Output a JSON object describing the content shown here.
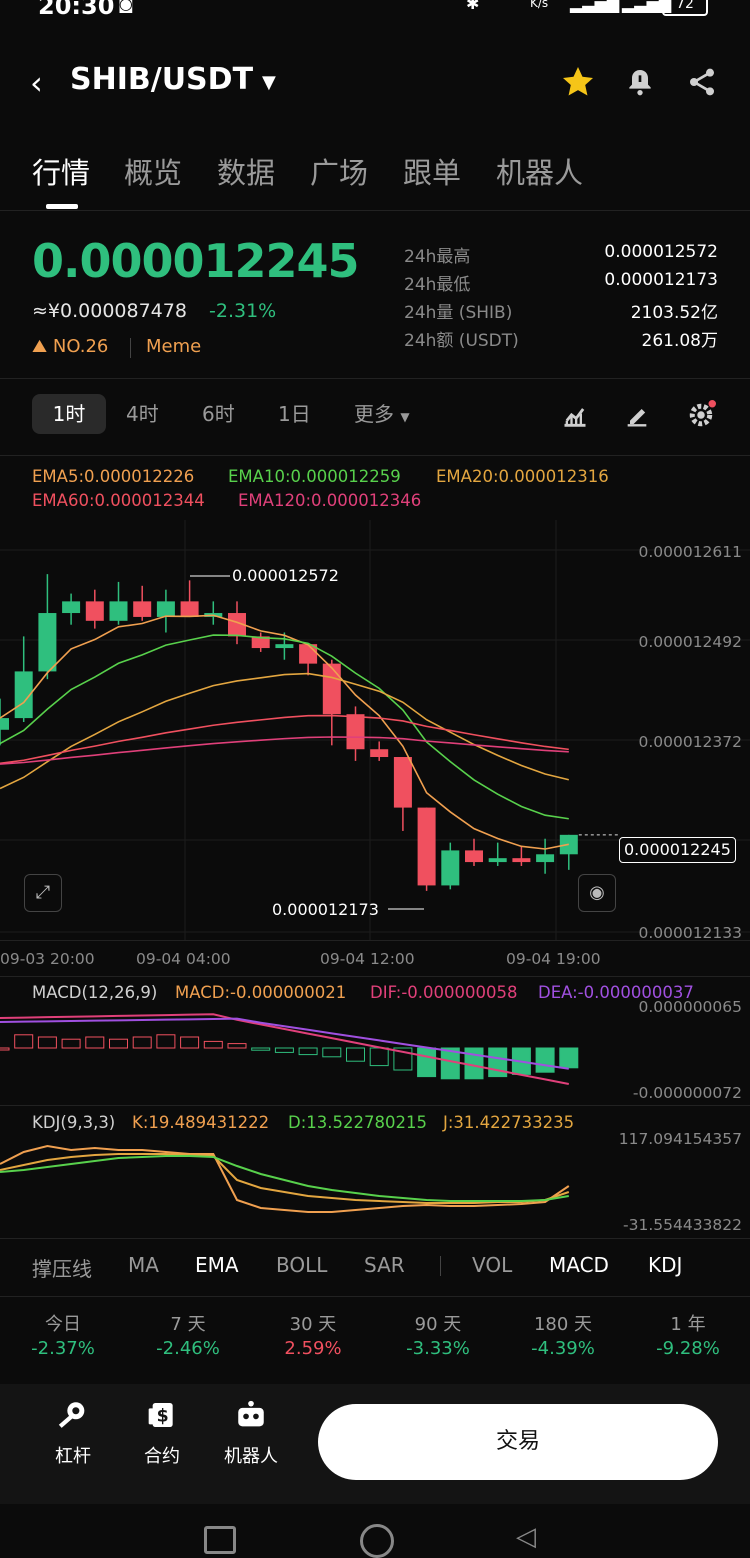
{
  "status_bar": {
    "time": "20:30",
    "battery": "72",
    "net_unit": "K/s"
  },
  "header": {
    "pair": "SHIB/USDT"
  },
  "tabs": [
    "行情",
    "概览",
    "数据",
    "广场",
    "跟单",
    "机器人"
  ],
  "ticker": {
    "price": "0.000012245",
    "fiat": "≈¥0.000087478",
    "change": "-2.31%",
    "rank": "NO.26",
    "tag": "Meme",
    "stats": [
      {
        "label": "24h最高",
        "value": "0.000012572"
      },
      {
        "label": "24h最低",
        "value": "0.000012173"
      },
      {
        "label": "24h量 (SHIB)",
        "value": "2103.52亿"
      },
      {
        "label": "24h额 (USDT)",
        "value": "261.08万"
      }
    ]
  },
  "timeframes": {
    "items": [
      "1时",
      "4时",
      "6时",
      "1日"
    ],
    "more": "更多"
  },
  "ema_legend": {
    "ema5": "EMA5:0.000012226",
    "ema10": "EMA10:0.000012259",
    "ema20": "EMA20:0.000012316",
    "ema60": "EMA60:0.000012344",
    "ema120": "EMA120:0.000012346"
  },
  "price_axis": [
    "0.000012611",
    "0.000012492",
    "0.000012372",
    "0.000012133"
  ],
  "current_price_tag": "0.000012245",
  "high_marker": "0.000012572",
  "low_marker": "0.000012173",
  "time_axis": [
    "09-03 20:00",
    "09-04 04:00",
    "09-04 12:00",
    "09-04 19:00"
  ],
  "macd": {
    "name": "MACD(12,26,9)",
    "macd": "MACD:-0.000000021",
    "dif": "DIF:-0.000000058",
    "dea": "DEA:-0.000000037",
    "axis_top": "0.000000065",
    "axis_bottom": "-0.000000072"
  },
  "kdj": {
    "name": "KDJ(9,3,3)",
    "k": "K:19.489431222",
    "d": "D:13.522780215",
    "j": "J:31.422733235",
    "axis_top": "117.094154357",
    "axis_bottom": "-31.554433822"
  },
  "indicator_tabs": [
    "撑压线",
    "MA",
    "EMA",
    "BOLL",
    "SAR",
    "VOL",
    "MACD",
    "KDJ"
  ],
  "performance": [
    {
      "period": "今日",
      "value": "-2.37%"
    },
    {
      "period": "7 天",
      "value": "-2.46%"
    },
    {
      "period": "30 天",
      "value": "2.59%"
    },
    {
      "period": "90 天",
      "value": "-3.33%"
    },
    {
      "period": "180 天",
      "value": "-4.39%"
    },
    {
      "period": "1 年",
      "value": "-9.28%"
    }
  ],
  "bottom_nav": {
    "leverage": "杠杆",
    "contract": "合约",
    "robot": "机器人",
    "trade": "交易"
  },
  "colors": {
    "up": "#2fbf7e",
    "down": "#f0505f",
    "accent": "#f0a050",
    "star": "#f5c518"
  },
  "chart_data": {
    "type": "candlestick",
    "interval": "1h",
    "candles_ohlc": [
      [
        1.238e-05,
        1.242e-05,
        1.236e-05,
        1.2395e-05
      ],
      [
        1.2395e-05,
        1.25e-05,
        1.239e-05,
        1.2455e-05
      ],
      [
        1.2455e-05,
        1.258e-05,
        1.2445e-05,
        1.253e-05
      ],
      [
        1.253e-05,
        1.2555e-05,
        1.2515e-05,
        1.2545e-05
      ],
      [
        1.2545e-05,
        1.256e-05,
        1.251e-05,
        1.252e-05
      ],
      [
        1.252e-05,
        1.257e-05,
        1.2515e-05,
        1.2545e-05
      ],
      [
        1.2545e-05,
        1.2565e-05,
        1.252e-05,
        1.2525e-05
      ],
      [
        1.2525e-05,
        1.256e-05,
        1.2505e-05,
        1.2545e-05
      ],
      [
        1.2545e-05,
        1.2572e-05,
        1.2525e-05,
        1.2525e-05
      ],
      [
        1.2525e-05,
        1.2545e-05,
        1.2515e-05,
        1.253e-05
      ],
      [
        1.253e-05,
        1.2545e-05,
        1.249e-05,
        1.25e-05
      ],
      [
        1.25e-05,
        1.2505e-05,
        1.248e-05,
        1.2485e-05
      ],
      [
        1.2485e-05,
        1.2505e-05,
        1.247e-05,
        1.249e-05
      ],
      [
        1.249e-05,
        1.249e-05,
        1.245e-05,
        1.2465e-05
      ],
      [
        1.2465e-05,
        1.247e-05,
        1.236e-05,
        1.24e-05
      ],
      [
        1.24e-05,
        1.241e-05,
        1.234e-05,
        1.2355e-05
      ],
      [
        1.2355e-05,
        1.2365e-05,
        1.234e-05,
        1.2345e-05
      ],
      [
        1.2345e-05,
        1.2345e-05,
        1.225e-05,
        1.228e-05
      ],
      [
        1.228e-05,
        1.228e-05,
        1.2173e-05,
        1.218e-05
      ],
      [
        1.218e-05,
        1.2235e-05,
        1.2175e-05,
        1.2225e-05
      ],
      [
        1.2225e-05,
        1.224e-05,
        1.2205e-05,
        1.221e-05
      ],
      [
        1.221e-05,
        1.2235e-05,
        1.2205e-05,
        1.2215e-05
      ],
      [
        1.2215e-05,
        1.223e-05,
        1.2205e-05,
        1.221e-05
      ],
      [
        1.221e-05,
        1.224e-05,
        1.2195e-05,
        1.222e-05
      ],
      [
        1.222e-05,
        1.2245e-05,
        1.22e-05,
        1.2245e-05
      ]
    ],
    "ylim": [
      1.2133e-05,
      1.2611e-05
    ],
    "xlabels": [
      "09-03 20:00",
      "09-04 04:00",
      "09-04 12:00",
      "09-04 19:00"
    ]
  }
}
